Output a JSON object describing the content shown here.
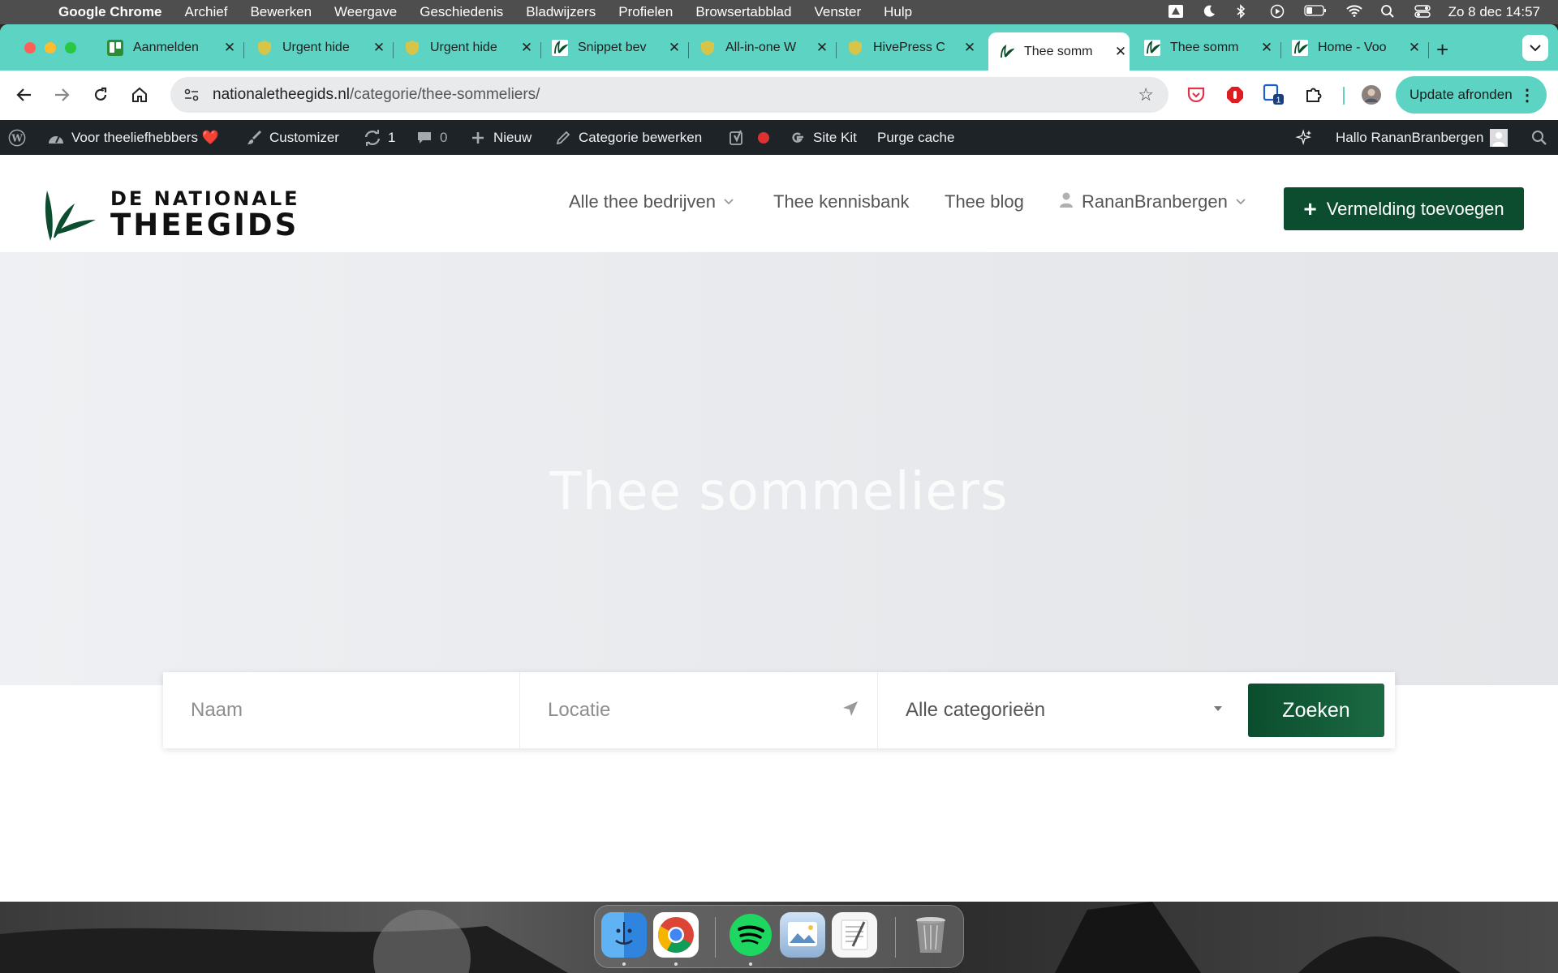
{
  "menubar": {
    "app_name": "Google Chrome",
    "items": [
      "Archief",
      "Bewerken",
      "Weergave",
      "Geschiedenis",
      "Bladwijzers",
      "Profielen",
      "Browsertabblad",
      "Venster",
      "Hulp"
    ],
    "datetime": "Zo 8 dec  14:57"
  },
  "tabs": [
    {
      "title": "Aanmelden",
      "favicon": "trello-icon"
    },
    {
      "title": "Urgent hide",
      "favicon": "shield-icon"
    },
    {
      "title": "Urgent hide",
      "favicon": "shield-icon"
    },
    {
      "title": "Snippet bev",
      "favicon": "theegids-icon"
    },
    {
      "title": "All-in-one W",
      "favicon": "shield-icon"
    },
    {
      "title": "HivePress C",
      "favicon": "shield-icon"
    },
    {
      "title": "Thee somm",
      "favicon": "theegids-icon",
      "active": true
    },
    {
      "title": "Thee somm",
      "favicon": "theegids-icon"
    },
    {
      "title": "Home - Voo",
      "favicon": "theegids-icon"
    }
  ],
  "toolbar": {
    "url_host": "nationaletheegids.nl",
    "url_path": "/categorie/thee-sommeliers/",
    "update_label": "Update afronden",
    "ext_badge": "1"
  },
  "adminbar": {
    "site_name": "Voor theeliefhebbers ❤️",
    "customizer": "Customizer",
    "updates_count": "1",
    "comments_count": "0",
    "new_label": "Nieuw",
    "edit_category": "Categorie bewerken",
    "site_kit": "Site Kit",
    "purge_cache": "Purge cache",
    "greeting": "Hallo RananBranbergen"
  },
  "site": {
    "logo_line1": "DE NATIONALE",
    "logo_line2": "THEEGIDS",
    "nav": {
      "companies": "Alle thee bedrijven",
      "knowledge": "Thee kennisbank",
      "blog": "Thee blog",
      "user": "RananBranbergen"
    },
    "cta_label": "Vermelding toevoegen"
  },
  "hero": {
    "title": "Thee sommeliers"
  },
  "search": {
    "name_placeholder": "Naam",
    "location_placeholder": "Locatie",
    "category_selected": "Alle categorieën",
    "button_label": "Zoeken"
  },
  "colors": {
    "tab_strip": "#5cd3c3",
    "brand_green": "#0b4d2e",
    "admin_bar": "#1d2327"
  }
}
